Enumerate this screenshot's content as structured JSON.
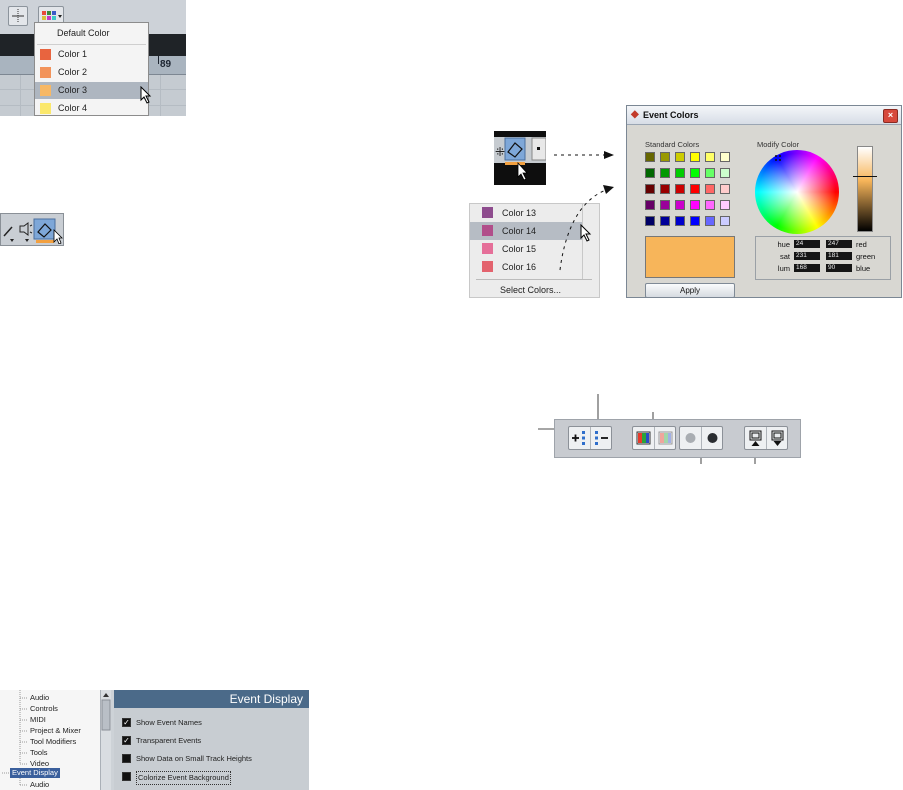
{
  "color_menu": {
    "default_label": "Default Color",
    "items": [
      {
        "label": "Color 1",
        "color": "#e8643f"
      },
      {
        "label": "Color 2",
        "color": "#f2935a"
      },
      {
        "label": "Color 3",
        "color": "#f7b865"
      },
      {
        "label": "Color 4",
        "color": "#fbe86c"
      }
    ],
    "ruler_number": "89"
  },
  "color_menu_2": {
    "items": [
      {
        "label": "Color 13",
        "color": "#8e4c8e"
      },
      {
        "label": "Color 14",
        "color": "#b14e8a"
      },
      {
        "label": "Color 15",
        "color": "#e56f99"
      },
      {
        "label": "Color 16",
        "color": "#e3636e"
      }
    ],
    "select_label": "Select Colors..."
  },
  "event_colors_dialog": {
    "title": "Event Colors",
    "close": "×",
    "standard_label": "Standard Colors",
    "modify_label": "Modify Color",
    "standard_colors": [
      [
        "#666600",
        "#999900",
        "#cccc00",
        "#ffff00",
        "#ffff66",
        "#ffffcc"
      ],
      [
        "#006600",
        "#009900",
        "#00cc00",
        "#00ff00",
        "#66ff66",
        "#ccffcc"
      ],
      [
        "#660000",
        "#990000",
        "#cc0000",
        "#ff0000",
        "#ff6666",
        "#ffcccc"
      ],
      [
        "#660066",
        "#990099",
        "#cc00cc",
        "#ff00ff",
        "#ff66ff",
        "#ffccff"
      ],
      [
        "#000066",
        "#000099",
        "#0000cc",
        "#0000ff",
        "#6666ff",
        "#ccccff"
      ]
    ],
    "preview_color": "#f7b55a",
    "hue_label": "hue",
    "hue_value": "24",
    "sat_label": "sat",
    "sat_value": "231",
    "lum_label": "lum",
    "lum_value": "168",
    "red_label": "red",
    "red_value": "247",
    "green_label": "green",
    "green_value": "181",
    "blue_label": "blue",
    "blue_value": "90",
    "apply_label": "Apply"
  },
  "preferences": {
    "tree_items": [
      "Audio",
      "Controls",
      "MIDI",
      "Project & Mixer",
      "Tool Modifiers",
      "Tools",
      "Video"
    ],
    "selected_item": "Event Display",
    "sub_item": "Audio",
    "header": "Event Display",
    "options": [
      {
        "label": "Show Event Names",
        "checked": "✓"
      },
      {
        "label": "Transparent Events",
        "checked": "✓"
      },
      {
        "label": "Show Data on Small Track Heights",
        "checked": ""
      },
      {
        "label": "Colorize Event Background",
        "checked": ""
      }
    ]
  }
}
